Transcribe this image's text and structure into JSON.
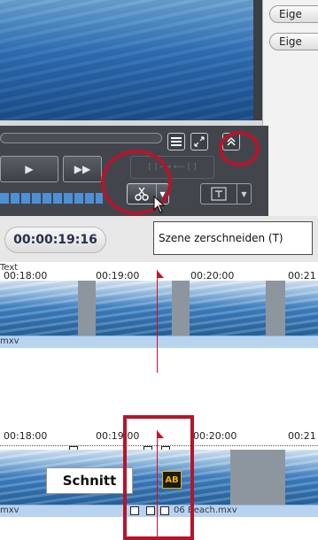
{
  "player": {
    "eig_button_1": "Eige",
    "eig_button_2": "Eige",
    "play_symbol": "▶",
    "forward_symbol": "▶▶",
    "inout_label": "[ ] ⟶ ⟵ [ ]",
    "timecode": "00:00:19:16",
    "tooltip": "Szene zerschneiden (T)",
    "split_icon": "scissors-icon",
    "text_icon": "text-frame-icon",
    "menu_icon": "list-icon",
    "expand_icon": "expand-arrows-icon",
    "collapse_icon": "double-chevron-up-icon"
  },
  "timeline_top": {
    "track_label": "Text",
    "ticks": [
      "00:18:00",
      "00:19:00",
      "00:20:00",
      "00:21"
    ],
    "clip_name": "mxv"
  },
  "timeline_bottom": {
    "ticks": [
      "00:18:00",
      "00:19:00",
      "00:20:00",
      "00:21"
    ],
    "schnitt_label": "Schnitt",
    "ab_badge": "AB",
    "clip_name_left": "mxv",
    "clip_name_right": "06 Beach.mxv"
  },
  "colors": {
    "highlight_red": "#b3162c",
    "playhead_red": "#d10f1f",
    "controls_dark": "#42464c",
    "clip_blue": "#3f80c2"
  }
}
